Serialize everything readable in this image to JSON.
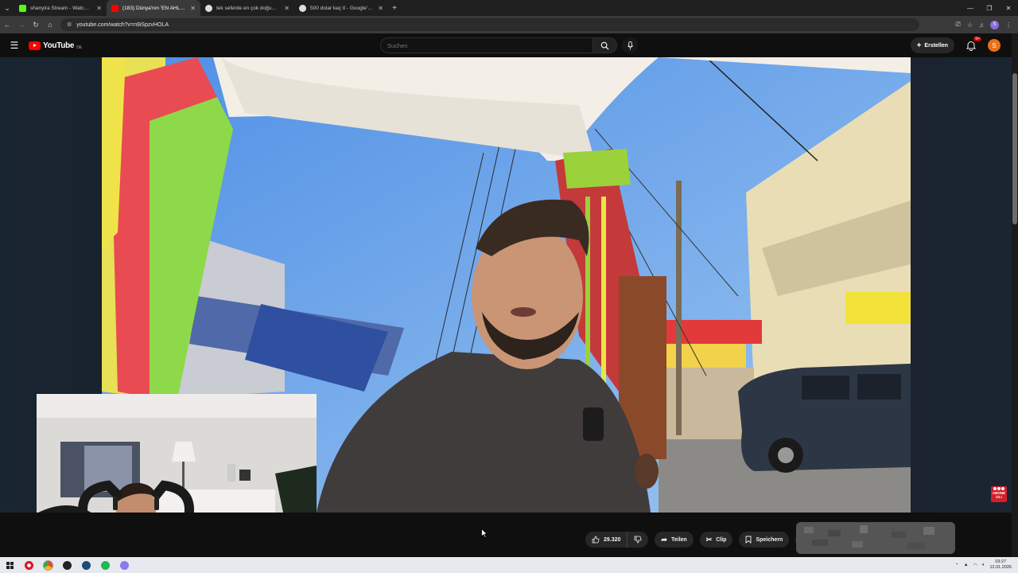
{
  "browser": {
    "tabs": [
      {
        "label": "shanyira Stream - Watch Live o",
        "favicon_color": "#53fc18",
        "active": false
      },
      {
        "label": "(183) Dünya'nın 'EN AHLAK",
        "favicon_color": "#ff0000",
        "active": true
      },
      {
        "label": "tek seferde en çok doğum yapı",
        "favicon_color": "#dddddd",
        "active": false
      },
      {
        "label": "500 dolar kaç tl - Google'da Ar",
        "favicon_color": "#dddddd",
        "active": false
      }
    ],
    "new_tab": "+",
    "url": "youtube.com/watch?v=n9iSpzvHOLA"
  },
  "youtube": {
    "logo_text": "YouTube",
    "region": "DE",
    "search_placeholder": "Suchen",
    "create_label": "Erstellen",
    "notification_badge": "9+",
    "avatar_letter": "S"
  },
  "actions": {
    "like_count": "29.320",
    "share_label": "Teilen",
    "clip_label": "Clip",
    "save_label": "Speichern",
    "more": "···"
  },
  "overlay": {
    "subscribe_sticker": "ABONE OL!"
  },
  "taskbar": {
    "time": "03:27",
    "date": "12.01.2026"
  },
  "colors": {
    "yt_red": "#ff0000",
    "background": "#0f0f0f",
    "pill": "#272727"
  }
}
